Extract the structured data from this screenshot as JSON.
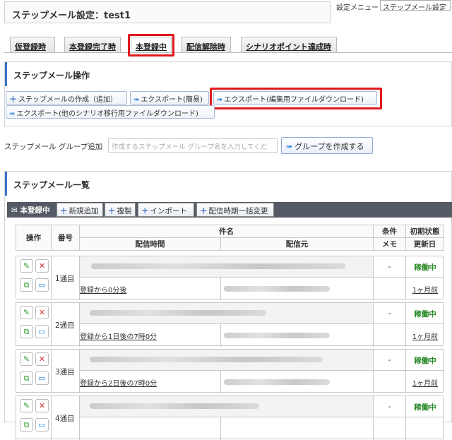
{
  "header": {
    "title": "ステップメール設定：test1",
    "settings_menu_label": "設定メニュー",
    "settings_menu_value": "ステップメール設定"
  },
  "tabs": [
    {
      "label": "仮登録時"
    },
    {
      "label": "本登録完了時"
    },
    {
      "label": "本登録中"
    },
    {
      "label": "配信解除時"
    },
    {
      "label": "シナリオポイント達成時"
    }
  ],
  "operations": {
    "heading": "ステップメール操作",
    "create_label": "ステップメールの作成（追加）",
    "export_simple_label": "エクスポート(簡易)",
    "export_edit_label": "エクスポート(編集用ファイルダウンロード)",
    "export_other_label": "エクスポート(他のシナリオ移行用ファイルダウンロード)"
  },
  "group": {
    "label": "ステップメール グループ追加",
    "placeholder": "作成するステップメール グループ名を入力してくだ",
    "create_button": "グループを作成する"
  },
  "list": {
    "heading": "ステップメール一覧",
    "state_tag": "本登録中",
    "new_button": "新規追加",
    "copy_button": "複製",
    "import_button": "インポート",
    "bulk_button": "配信時期一括変更",
    "columns": {
      "actions": "操作",
      "number": "番号",
      "subject": "件名",
      "timing": "配信時間",
      "sender": "配信元",
      "condition": "条件",
      "memo": "メモ",
      "initial_status": "初期状態",
      "updated": "更新日"
    },
    "rows": [
      {
        "number": "1通目",
        "timing": "登録から0分後",
        "condition": "-",
        "status": "稼働中",
        "updated": "1ヶ月前"
      },
      {
        "number": "2通目",
        "timing": "登録から1日後の7時0分",
        "condition": "-",
        "status": "稼働中",
        "updated": "1ヶ月前"
      },
      {
        "number": "3通目",
        "timing": "登録から2日後の7時0分",
        "condition": "-",
        "status": "稼働中",
        "updated": "1ヶ月前"
      },
      {
        "number": "4通目",
        "timing": "",
        "condition": "-",
        "status": "稼働中",
        "updated": ""
      }
    ]
  },
  "colors": {
    "highlight": "#e0181d",
    "accent": "#3a73c7",
    "status_active": "#2a8a2a",
    "toolbar_bg": "#555b64"
  }
}
